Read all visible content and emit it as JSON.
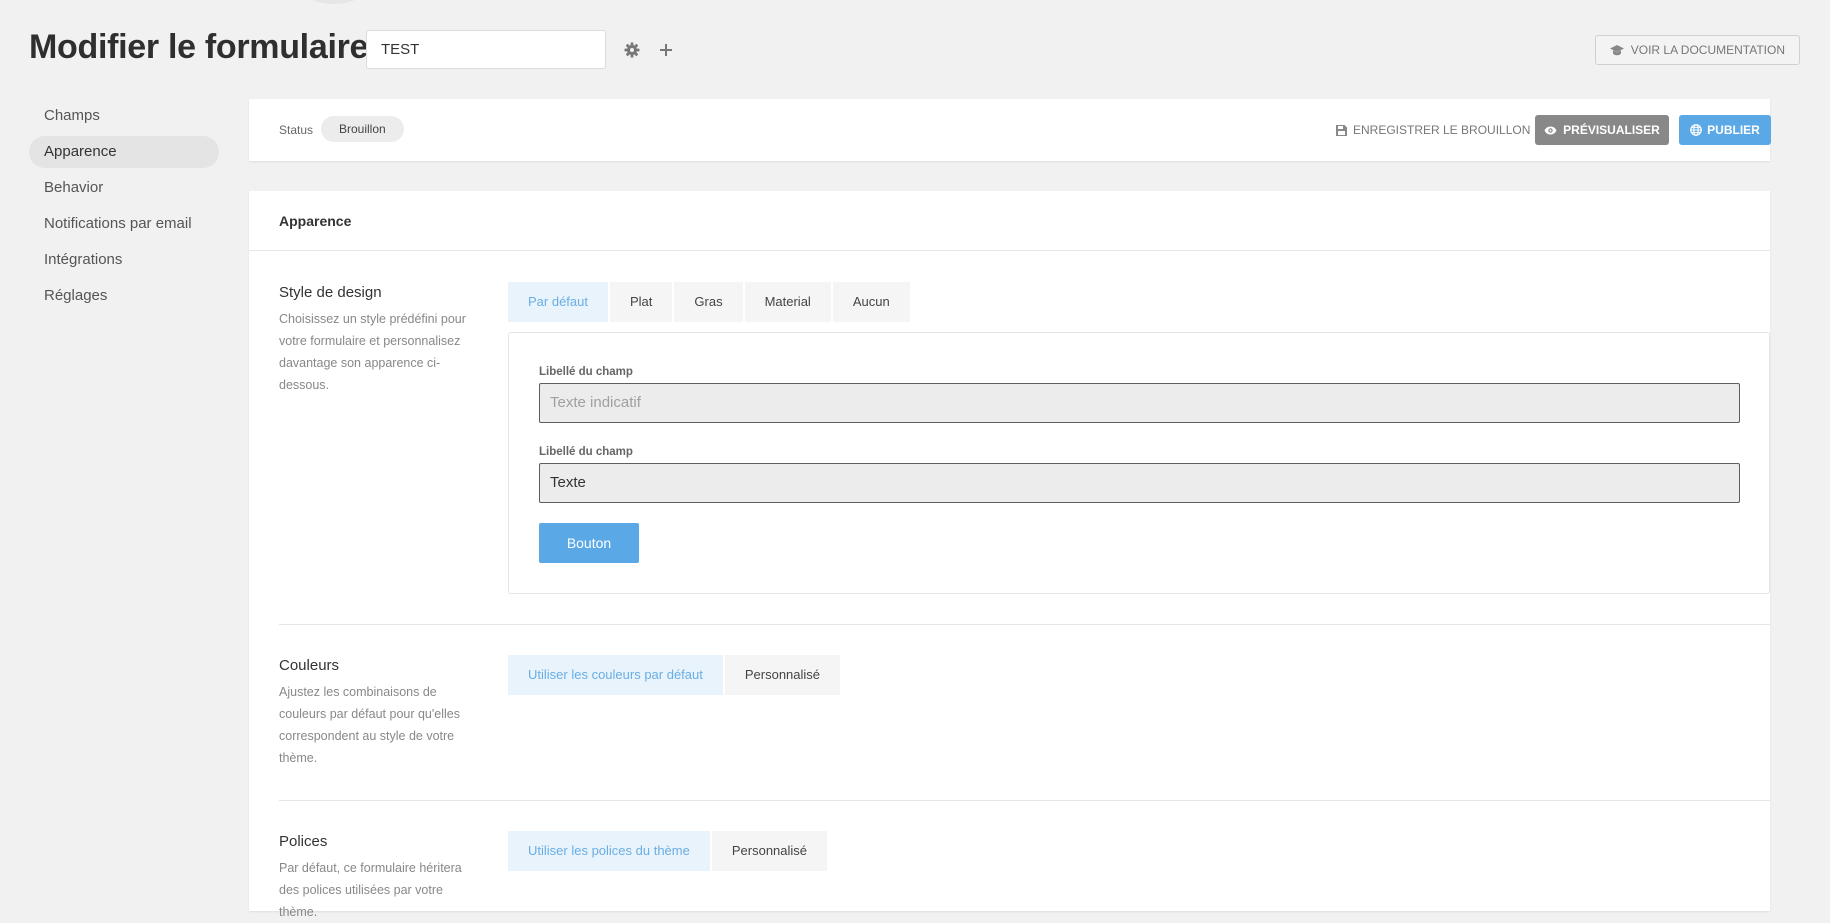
{
  "header": {
    "title": "Modifier le formulaire",
    "form_name": "TEST",
    "doc_button": "VOIR LA DOCUMENTATION"
  },
  "sidebar": {
    "items": [
      {
        "label": "Champs",
        "active": false
      },
      {
        "label": "Apparence",
        "active": true
      },
      {
        "label": "Behavior",
        "active": false
      },
      {
        "label": "Notifications par email",
        "active": false
      },
      {
        "label": "Intégrations",
        "active": false
      },
      {
        "label": "Réglages",
        "active": false
      }
    ]
  },
  "status_bar": {
    "status_label": "Status",
    "status_value": "Brouillon",
    "save_draft": "ENREGISTRER LE BROUILLON",
    "preview": "PRÉVISUALISER",
    "publish": "PUBLIER"
  },
  "card": {
    "title": "Apparence",
    "design": {
      "title": "Style de design",
      "description": "Choisissez un style prédéfini pour votre formulaire et personnalisez davantage son apparence ci-dessous.",
      "options": [
        "Par défaut",
        "Plat",
        "Gras",
        "Material",
        "Aucun"
      ],
      "selected": "Par défaut",
      "preview": {
        "label1": "Libellé du champ",
        "placeholder": "Texte indicatif",
        "label2": "Libellé du champ",
        "value": "Texte",
        "button": "Bouton"
      }
    },
    "colors": {
      "title": "Couleurs",
      "description": "Ajustez les combinaisons de couleurs par défaut pour qu'elles correspondent au style de votre thème.",
      "options": [
        "Utiliser les couleurs par défaut",
        "Personnalisé"
      ],
      "selected": "Utiliser les couleurs par défaut"
    },
    "fonts": {
      "title": "Polices",
      "description": "Par défaut, ce formulaire héritera des polices utilisées par votre thème.",
      "options": [
        "Utiliser les polices du thème",
        "Personnalisé"
      ],
      "selected": "Utiliser les polices du thème"
    }
  },
  "colors": {
    "background": "#f1f1f1",
    "primary": "#5aa8e6",
    "preview_button_bg": "#888888",
    "active_segment_bg": "#e8f3fc",
    "active_segment_text": "#6aaee4"
  }
}
